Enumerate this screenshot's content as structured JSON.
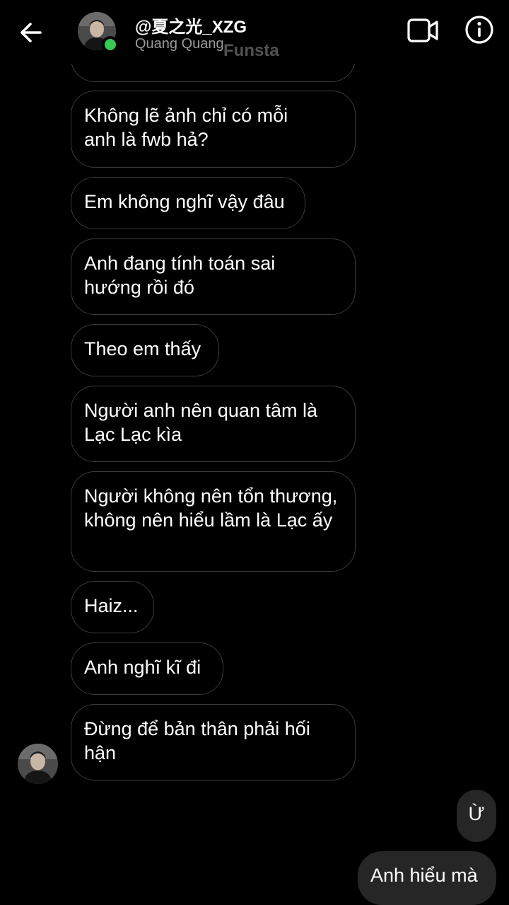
{
  "header": {
    "title": "@夏之光_XZG",
    "subtitle": "Quang Quang",
    "watermark": "Funsta",
    "icons": {
      "back": "arrow-left-icon",
      "video": "video-camera-icon",
      "info": "info-icon"
    },
    "online_color": "#39c954"
  },
  "messages": {
    "incoming": [
      "Không lẽ  ảnh chỉ có mỗi anh là fwb hả?",
      "Em không nghĩ vậy đâu",
      "Anh đang tính toán sai hướng rồi đó",
      "Theo em thấy",
      "Người anh nên quan tâm là Lạc Lạc kìa",
      "Người không nên tổn thương, không nên hiểu lầm là Lạc ấy",
      "Haiz...",
      "Anh nghĩ kĩ đi",
      "Đừng để bản thân phải hối hận"
    ],
    "outgoing": [
      "Ừ",
      "Anh hiểu mà"
    ]
  }
}
